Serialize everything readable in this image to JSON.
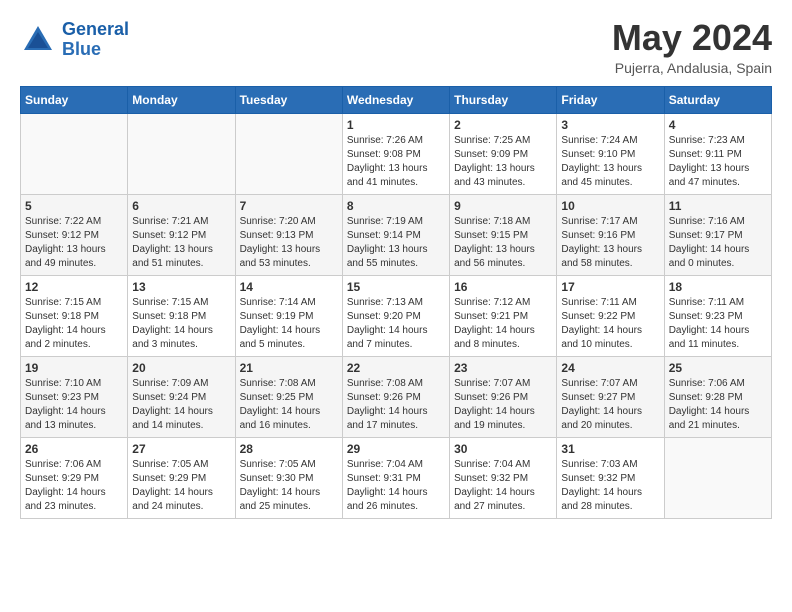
{
  "logo": {
    "text_general": "General",
    "text_blue": "Blue"
  },
  "title": "May 2024",
  "location": "Pujerra, Andalusia, Spain",
  "headers": [
    "Sunday",
    "Monday",
    "Tuesday",
    "Wednesday",
    "Thursday",
    "Friday",
    "Saturday"
  ],
  "weeks": [
    [
      {
        "day": "",
        "info": ""
      },
      {
        "day": "",
        "info": ""
      },
      {
        "day": "",
        "info": ""
      },
      {
        "day": "1",
        "info": "Sunrise: 7:26 AM\nSunset: 9:08 PM\nDaylight: 13 hours\nand 41 minutes."
      },
      {
        "day": "2",
        "info": "Sunrise: 7:25 AM\nSunset: 9:09 PM\nDaylight: 13 hours\nand 43 minutes."
      },
      {
        "day": "3",
        "info": "Sunrise: 7:24 AM\nSunset: 9:10 PM\nDaylight: 13 hours\nand 45 minutes."
      },
      {
        "day": "4",
        "info": "Sunrise: 7:23 AM\nSunset: 9:11 PM\nDaylight: 13 hours\nand 47 minutes."
      }
    ],
    [
      {
        "day": "5",
        "info": "Sunrise: 7:22 AM\nSunset: 9:12 PM\nDaylight: 13 hours\nand 49 minutes."
      },
      {
        "day": "6",
        "info": "Sunrise: 7:21 AM\nSunset: 9:12 PM\nDaylight: 13 hours\nand 51 minutes."
      },
      {
        "day": "7",
        "info": "Sunrise: 7:20 AM\nSunset: 9:13 PM\nDaylight: 13 hours\nand 53 minutes."
      },
      {
        "day": "8",
        "info": "Sunrise: 7:19 AM\nSunset: 9:14 PM\nDaylight: 13 hours\nand 55 minutes."
      },
      {
        "day": "9",
        "info": "Sunrise: 7:18 AM\nSunset: 9:15 PM\nDaylight: 13 hours\nand 56 minutes."
      },
      {
        "day": "10",
        "info": "Sunrise: 7:17 AM\nSunset: 9:16 PM\nDaylight: 13 hours\nand 58 minutes."
      },
      {
        "day": "11",
        "info": "Sunrise: 7:16 AM\nSunset: 9:17 PM\nDaylight: 14 hours\nand 0 minutes."
      }
    ],
    [
      {
        "day": "12",
        "info": "Sunrise: 7:15 AM\nSunset: 9:18 PM\nDaylight: 14 hours\nand 2 minutes."
      },
      {
        "day": "13",
        "info": "Sunrise: 7:15 AM\nSunset: 9:18 PM\nDaylight: 14 hours\nand 3 minutes."
      },
      {
        "day": "14",
        "info": "Sunrise: 7:14 AM\nSunset: 9:19 PM\nDaylight: 14 hours\nand 5 minutes."
      },
      {
        "day": "15",
        "info": "Sunrise: 7:13 AM\nSunset: 9:20 PM\nDaylight: 14 hours\nand 7 minutes."
      },
      {
        "day": "16",
        "info": "Sunrise: 7:12 AM\nSunset: 9:21 PM\nDaylight: 14 hours\nand 8 minutes."
      },
      {
        "day": "17",
        "info": "Sunrise: 7:11 AM\nSunset: 9:22 PM\nDaylight: 14 hours\nand 10 minutes."
      },
      {
        "day": "18",
        "info": "Sunrise: 7:11 AM\nSunset: 9:23 PM\nDaylight: 14 hours\nand 11 minutes."
      }
    ],
    [
      {
        "day": "19",
        "info": "Sunrise: 7:10 AM\nSunset: 9:23 PM\nDaylight: 14 hours\nand 13 minutes."
      },
      {
        "day": "20",
        "info": "Sunrise: 7:09 AM\nSunset: 9:24 PM\nDaylight: 14 hours\nand 14 minutes."
      },
      {
        "day": "21",
        "info": "Sunrise: 7:08 AM\nSunset: 9:25 PM\nDaylight: 14 hours\nand 16 minutes."
      },
      {
        "day": "22",
        "info": "Sunrise: 7:08 AM\nSunset: 9:26 PM\nDaylight: 14 hours\nand 17 minutes."
      },
      {
        "day": "23",
        "info": "Sunrise: 7:07 AM\nSunset: 9:26 PM\nDaylight: 14 hours\nand 19 minutes."
      },
      {
        "day": "24",
        "info": "Sunrise: 7:07 AM\nSunset: 9:27 PM\nDaylight: 14 hours\nand 20 minutes."
      },
      {
        "day": "25",
        "info": "Sunrise: 7:06 AM\nSunset: 9:28 PM\nDaylight: 14 hours\nand 21 minutes."
      }
    ],
    [
      {
        "day": "26",
        "info": "Sunrise: 7:06 AM\nSunset: 9:29 PM\nDaylight: 14 hours\nand 23 minutes."
      },
      {
        "day": "27",
        "info": "Sunrise: 7:05 AM\nSunset: 9:29 PM\nDaylight: 14 hours\nand 24 minutes."
      },
      {
        "day": "28",
        "info": "Sunrise: 7:05 AM\nSunset: 9:30 PM\nDaylight: 14 hours\nand 25 minutes."
      },
      {
        "day": "29",
        "info": "Sunrise: 7:04 AM\nSunset: 9:31 PM\nDaylight: 14 hours\nand 26 minutes."
      },
      {
        "day": "30",
        "info": "Sunrise: 7:04 AM\nSunset: 9:32 PM\nDaylight: 14 hours\nand 27 minutes."
      },
      {
        "day": "31",
        "info": "Sunrise: 7:03 AM\nSunset: 9:32 PM\nDaylight: 14 hours\nand 28 minutes."
      },
      {
        "day": "",
        "info": ""
      }
    ]
  ]
}
